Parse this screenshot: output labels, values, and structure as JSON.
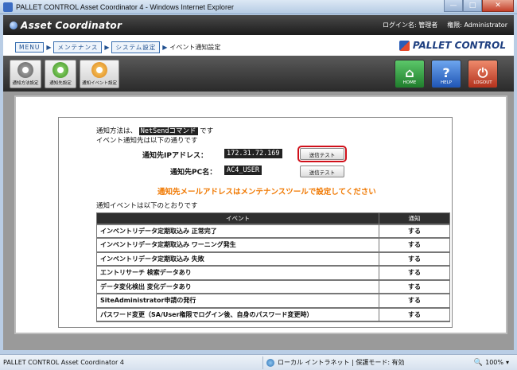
{
  "window": {
    "title": "PALLET CONTROL Asset Coordinator 4 - Windows Internet Explorer",
    "minimize_glyph": "—",
    "maximize_glyph": "□",
    "close_glyph": "✕"
  },
  "header": {
    "app_name": "Asset Coordinator",
    "login_name_label": "ログイン名: 管理者",
    "authority_label": "権限: Administrator"
  },
  "breadcrumb": {
    "items": [
      "MENU",
      "メンテナンス",
      "システム設定"
    ],
    "separator": "▶",
    "current": "イベント通知設定"
  },
  "brand": {
    "name": "PALLET CONTROL"
  },
  "toolbar": {
    "left_buttons": [
      {
        "label": "通知方法設定",
        "icon": "gear-gray-icon"
      },
      {
        "label": "通知先設定",
        "icon": "gear-green-icon"
      },
      {
        "label": "通知イベント設定",
        "icon": "gear-orange-icon"
      }
    ],
    "right_buttons": [
      {
        "label": "HOME",
        "glyph": "⌂",
        "color": "#2e9a3a"
      },
      {
        "label": "HELP",
        "glyph": "?",
        "color": "#2f6fd0"
      },
      {
        "label": "LOGOUT",
        "glyph": "⏻",
        "color": "#c9402a"
      }
    ]
  },
  "main": {
    "notify_method_prefix": "通知方法は、",
    "notify_method_value": "NetSendコマンド",
    "notify_method_suffix": "です",
    "notify_target_intro": "イベント通知先は以下の通りです",
    "ip_label": "通知先IPアドレス：",
    "ip_value": "172.31.72.169",
    "pc_label": "通知先PC名：",
    "pc_value": "AC4_USER",
    "send_test_label": "送信テスト",
    "warning": "通知先メールアドレスはメンテナンスツールで設定してください",
    "events_intro": "通知イベントは以下のとおりです",
    "table": {
      "headers": [
        "イベント",
        "通知"
      ],
      "rows": [
        [
          "インベントリデータ定期取込み 正常完了",
          "する"
        ],
        [
          "インベントリデータ定期取込み ワーニング発生",
          "する"
        ],
        [
          "インベントリデータ定期取込み 失敗",
          "する"
        ],
        [
          "エントリサーチ 検索データあり",
          "する"
        ],
        [
          "データ変化検出 変化データあり",
          "する"
        ],
        [
          "SiteAdministrator申請の発行",
          "する"
        ],
        [
          "パスワード変更（SA/User権限でログイン後、自身のパスワード変更時）",
          "する"
        ]
      ]
    }
  },
  "statusbar": {
    "title": "PALLET CONTROL Asset Coordinator 4",
    "zone": "ローカル イントラネット | 保護モード: 有効",
    "zoom": "100%"
  }
}
